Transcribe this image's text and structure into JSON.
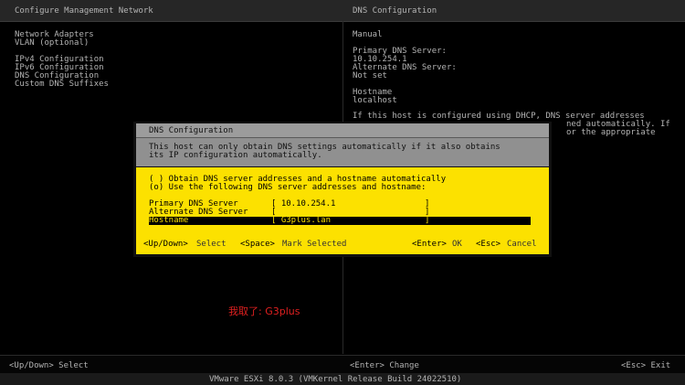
{
  "header": {
    "left_title": "Configure Management Network",
    "right_title": "DNS Configuration"
  },
  "menu": {
    "items": [
      {
        "label": "Network Adapters"
      },
      {
        "label": "VLAN (optional)"
      },
      {
        "label": "IPv4 Configuration"
      },
      {
        "label": "IPv6 Configuration"
      },
      {
        "label": "DNS Configuration"
      },
      {
        "label": "Custom DNS Suffixes"
      }
    ]
  },
  "info": {
    "mode": "Manual",
    "primary_label": "Primary DNS Server:",
    "primary_value": "10.10.254.1",
    "alternate_label": "Alternate DNS Server:",
    "alternate_value": "Not set",
    "hostname_label": "Hostname",
    "hostname_value": "localhost",
    "note_line1": "If this host is configured using DHCP, DNS server addresses",
    "note_line2": "ned automatically. If",
    "note_line3": "or the appropriate"
  },
  "dialog": {
    "title": "DNS Configuration",
    "desc_line1": "This host can only obtain DNS settings automatically if it also obtains",
    "desc_line2": "its IP configuration automatically.",
    "option_auto": "( ) Obtain DNS server addresses and a hostname automatically",
    "option_manual": "(o) Use the following DNS server addresses and hostname:",
    "fields": {
      "primary_label": "Primary DNS Server",
      "primary_value": "[ 10.10.254.1                  ]",
      "alternate_label": "Alternate DNS Server",
      "alternate_value": "[                              ]",
      "hostname_label": "Hostname",
      "hostname_value": "[ G3plus.lan                   ]"
    },
    "keys": {
      "updown_key": "<Up/Down>",
      "updown_action": "Select",
      "space_key": "<Space>",
      "space_action": "Mark Selected",
      "enter_key": "<Enter>",
      "enter_action": "OK",
      "esc_key": "<Esc>",
      "esc_action": "Cancel"
    }
  },
  "annotation": "我取了: G3plus",
  "bottom": {
    "left": "<Up/Down> Select",
    "center": "<Enter> Change",
    "right": "<Esc> Exit"
  },
  "footer": "VMware ESXi 8.0.3 (VMKernel Release Build 24022510)"
}
